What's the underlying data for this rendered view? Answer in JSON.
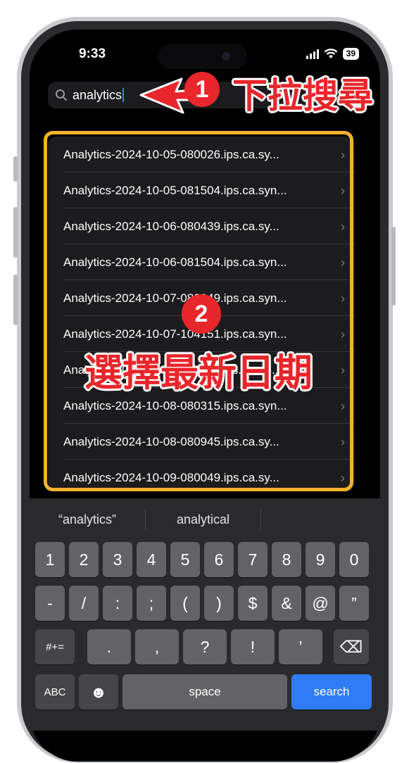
{
  "status_bar": {
    "time": "9:33",
    "battery": "39"
  },
  "search": {
    "query": "analytics"
  },
  "files": [
    "Analytics-2024-10-05-080026.ips.ca.sy...",
    "Analytics-2024-10-05-081504.ips.ca.syn...",
    "Analytics-2024-10-06-080439.ips.ca.sy...",
    "Analytics-2024-10-06-081504.ips.ca.syn...",
    "Analytics-2024-10-07-080049.ips.ca.syn...",
    "Analytics-2024-10-07-104151.ips.ca.syn...",
    "Analytics-2024-10-07-125113.ips.ca.sy...",
    "Analytics-2024-10-08-080315.ips.ca.syn...",
    "Analytics-2024-10-08-080945.ips.ca.sy...",
    "Analytics-2024-10-09-080049.ips.ca.sy..."
  ],
  "annotations": {
    "step1_number": "1",
    "step1_text": "下拉搜尋",
    "step2_number": "2",
    "step2_text": "選擇最新日期"
  },
  "keyboard": {
    "predictions": [
      "“analytics”",
      "analytical",
      ""
    ],
    "row1": [
      "1",
      "2",
      "3",
      "4",
      "5",
      "6",
      "7",
      "8",
      "9",
      "0"
    ],
    "row2": [
      "-",
      "/",
      ":",
      ";",
      "(",
      ")",
      "$",
      "&",
      "@",
      "”"
    ],
    "row3": [
      ".",
      ",",
      "?",
      "!",
      "’"
    ],
    "symbols_key": "#+=",
    "abc_key": "ABC",
    "space_key": "space",
    "search_key": "search",
    "emoji_glyph": "☻",
    "delete_glyph": "⌫"
  },
  "colors": {
    "accent_blue": "#2f7cf6",
    "annotation_red": "#e8262b",
    "highlight_orange": "#f7b12c"
  }
}
